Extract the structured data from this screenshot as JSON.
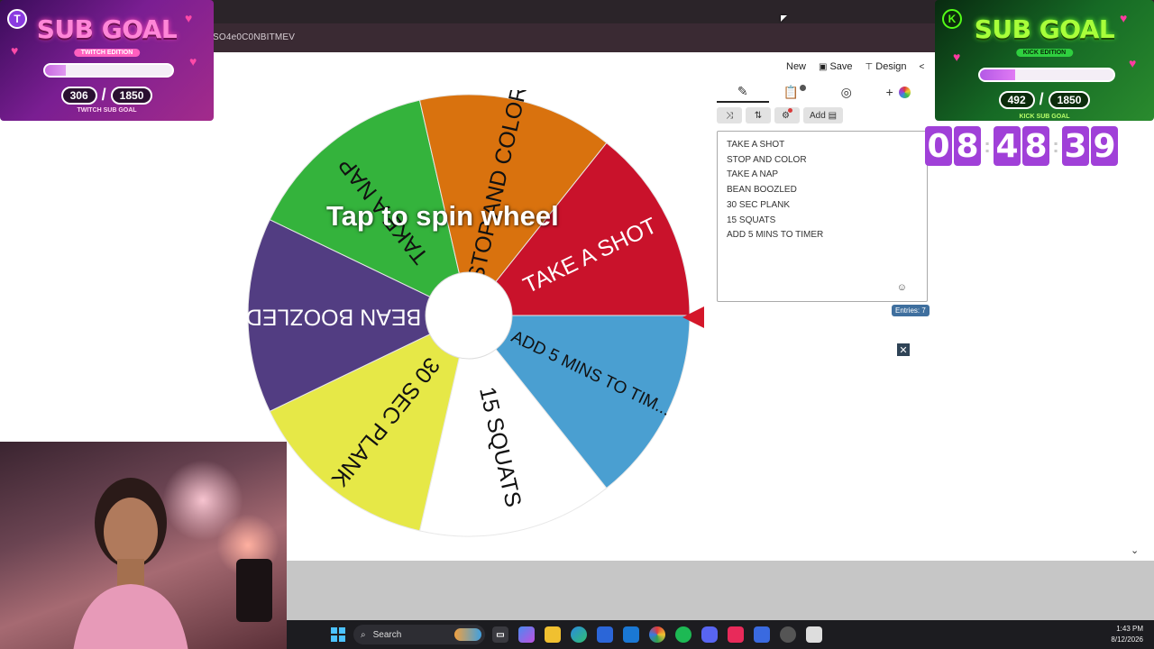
{
  "browser": {
    "url_fragment": "SO4e0C0NBITMEV"
  },
  "toolbar": {
    "new_label": "New",
    "save_label": "Save",
    "design_label": "Design"
  },
  "editor": {
    "tabs": [
      {
        "icon": "pencil-icon"
      },
      {
        "icon": "clipboard-icon"
      },
      {
        "icon": "eye-slash-icon"
      },
      {
        "icon": "plus-icon"
      }
    ],
    "buttons": {
      "shuffle_icon": "shuffle-icon",
      "sort_icon": "sort-icon",
      "settings_icon": "gear-icon",
      "add_image_label": "Add"
    },
    "entries": [
      "TAKE A SHOT",
      "STOP AND COLOR",
      "TAKE A NAP",
      "BEAN BOOZLED",
      "30 SEC PLANK",
      "15 SQUATS",
      "ADD 5 MINS TO TIMER"
    ],
    "entries_count_label": "Entries: 7"
  },
  "wheel": {
    "prompt": "Tap to spin wheel",
    "colors": {
      "red": "#c9122b",
      "blue": "#4a9fd1",
      "white": "#ffffff",
      "yellow": "#e6e847",
      "purple": "#523d82",
      "green": "#34b33c",
      "orange": "#d9720e"
    },
    "segments": [
      {
        "label": "TAKE A SHOT",
        "color": "#c9122b",
        "text_color": "#ffffff"
      },
      {
        "label": "ADD 5 MINS TO TIM...",
        "color": "#4a9fd1",
        "text_color": "#111111"
      },
      {
        "label": "15 SQUATS",
        "color": "#ffffff",
        "text_color": "#111111"
      },
      {
        "label": "30 SEC PLANK",
        "color": "#e6e847",
        "text_color": "#111111"
      },
      {
        "label": "BEAN BOOZLED",
        "color": "#523d82",
        "text_color": "#ffffff"
      },
      {
        "label": "TAKE A NAP",
        "color": "#34b33c",
        "text_color": "#111111"
      },
      {
        "label": "STOP AND COLOR",
        "color": "#d9720e",
        "text_color": "#111111"
      }
    ]
  },
  "twitch_goal": {
    "title": "SUB GOAL",
    "edition": "TWITCH EDITION",
    "current": "306",
    "target": "1850",
    "caption": "TWITCH SUB GOAL",
    "progress": 0.165
  },
  "kick_goal": {
    "title": "SUB GOAL",
    "edition": "KICK EDITION",
    "current": "492",
    "target": "1850",
    "caption": "KICK SUB GOAL",
    "progress": 0.266
  },
  "countdown": {
    "hours": [
      "0",
      "8"
    ],
    "minutes": [
      "4",
      "8"
    ],
    "seconds": [
      "3",
      "9"
    ]
  },
  "taskbar": {
    "search_label": "Search",
    "time": "1:43 PM",
    "date": "8/12/2026"
  }
}
